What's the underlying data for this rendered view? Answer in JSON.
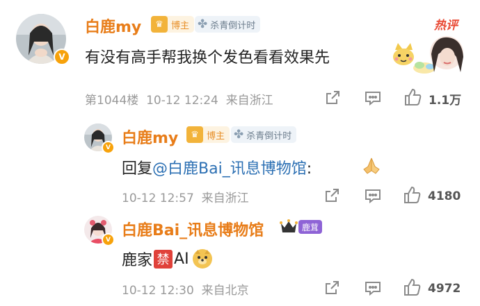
{
  "comments": [
    {
      "username": "白鹿my",
      "badge_label": "博主",
      "event_tag": "杀青倒计时",
      "hot_label": "热评",
      "content": "有没有高手帮我换个发色看看效果先",
      "floor": "第1044楼",
      "time": "10-12 12:24",
      "location": "来自浙江",
      "like_count": "1.1万"
    },
    {
      "username": "白鹿my",
      "badge_label": "博主",
      "event_tag": "杀青倒计时",
      "reply_prefix": "回复",
      "mention": "@白鹿Bai_讯息博物馆",
      "reply_suffix": ":",
      "time": "10-12 12:57",
      "location": "来自浙江",
      "like_count": "4180"
    },
    {
      "username": "白鹿Bai_讯息博物馆",
      "badge_label": "鹿茸",
      "content_prefix": "鹿家",
      "ban_char": "禁",
      "content_suffix": "AI",
      "time": "10-12 12:30",
      "location": "来自北京",
      "like_count": "4972"
    }
  ],
  "icons": {
    "verified": "V",
    "crown": "♛",
    "clover": "✤",
    "share": "share-icon",
    "comment": "comment-icon",
    "like": "thumbs-up-icon"
  },
  "colors": {
    "username": "#e87d19",
    "hot": "#e94a35",
    "mention": "#2b6fb3",
    "verified": "#f7a20b",
    "ban_badge": "#e0413a"
  }
}
